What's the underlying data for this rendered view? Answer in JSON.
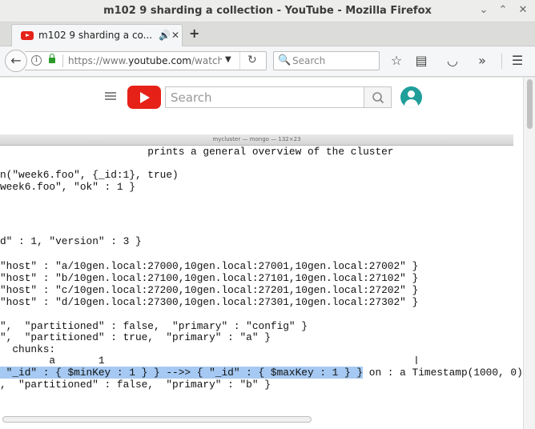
{
  "window": {
    "title": "m102 9 sharding a collection - YouTube - Mozilla Firefox",
    "minimize_glyph": "⌄",
    "maximize_glyph": "⌃",
    "close_glyph": "✕"
  },
  "tabs": [
    {
      "label": "m102 9 sharding a co...",
      "audio_glyph": "🔊",
      "close_glyph": "✕",
      "active": true
    }
  ],
  "new_tab_glyph": "+",
  "navbar": {
    "back_glyph": "←",
    "info_glyph": "i",
    "url_prefix": "https://www.",
    "url_domain": "youtube.com",
    "url_suffix": "/watch?v",
    "url_dropdown_glyph": "▼",
    "reload_glyph": "↻",
    "search_icon_glyph": "🔍",
    "search_placeholder": "Search",
    "bookmark_glyph": "☆",
    "library_glyph": "▤",
    "pocket_glyph": "◡",
    "overflow_glyph": "»",
    "menu_glyph": "☰"
  },
  "youtube": {
    "search_placeholder": "Search",
    "search_button_glyph": "🔍"
  },
  "terminal": {
    "window_title": "mycluster — mongo — 132×23",
    "lines": [
      "                        prints a general overview of the cluster",
      "",
      "n(\"week6.foo\", {_id:1}, true)",
      "week6.foo\", \"ok\" : 1 }",
      "",
      "",
      "",
      "d\" : 1, \"version\" : 3 }",
      "",
      "\"host\" : \"a/10gen.local:27000,10gen.local:27001,10gen.local:27002\" }",
      "\"host\" : \"b/10gen.local:27100,10gen.local:27101,10gen.local:27102\" }",
      "\"host\" : \"c/10gen.local:27200,10gen.local:27201,10gen.local:27202\" }",
      "\"host\" : \"d/10gen.local:27300,10gen.local:27301,10gen.local:27302\" }",
      "",
      "\",  \"partitioned\" : false,  \"primary\" : \"config\" }",
      "\",  \"partitioned\" : true,  \"primary\" : \"a\" }",
      "  chunks:",
      "        a       1",
      "",
      ",  \"partitioned\" : false,  \"primary\" : \"b\" }"
    ],
    "highlight_line": " \"_id\" : { $minKey : 1 } } -->> { \"_id\" : { $maxKey : 1 } }",
    "highlight_tail": " on : a Timestamp(1000, 0)",
    "cursor_glyph": "I"
  }
}
